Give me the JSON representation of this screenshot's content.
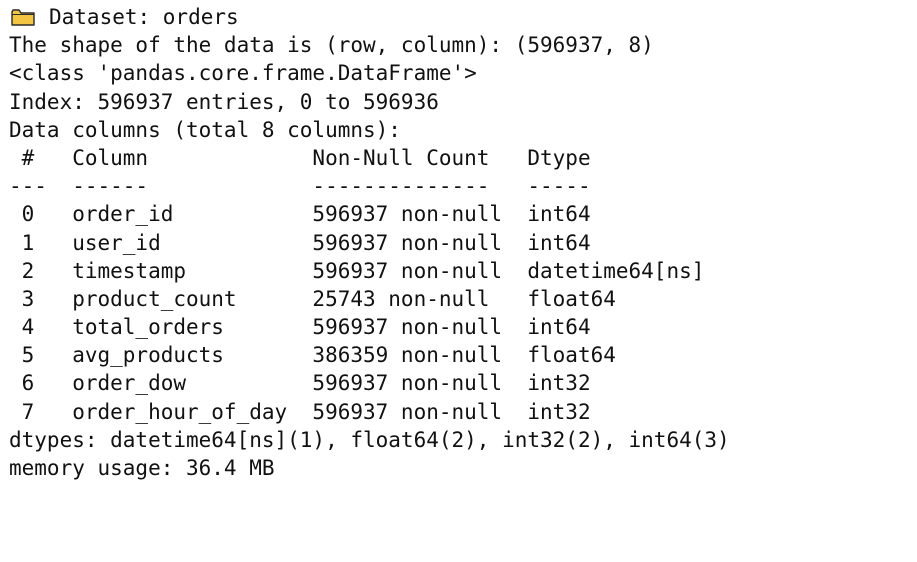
{
  "header": {
    "dataset_line": "Dataset: orders",
    "shape_line": "The shape of the data is (row, column): (596937, 8)",
    "class_line": "<class 'pandas.core.frame.DataFrame'>",
    "index_line": "Index: 596937 entries, 0 to 596936",
    "columns_line": "Data columns (total 8 columns):"
  },
  "table": {
    "header_line": " #   Column             Non-Null Count   Dtype         ",
    "separator_line": "---  ------             --------------   -----         ",
    "rows": [
      " 0   order_id           596937 non-null  int64         ",
      " 1   user_id            596937 non-null  int64         ",
      " 2   timestamp          596937 non-null  datetime64[ns]",
      " 3   product_count      25743 non-null   float64       ",
      " 4   total_orders       596937 non-null  int64         ",
      " 5   avg_products       386359 non-null  float64       ",
      " 6   order_dow          596937 non-null  int32         ",
      " 7   order_hour_of_day  596937 non-null  int32         "
    ]
  },
  "footer": {
    "dtypes_line": "dtypes: datetime64[ns](1), float64(2), int32(2), int64(3)",
    "memory_line": "memory usage: 36.4 MB"
  },
  "colors": {
    "folder_fill": "#F4C542",
    "folder_outline": "#2b2b2b",
    "text": "#111111",
    "background": "#ffffff"
  },
  "icons": {
    "dataset": "folder-icon"
  }
}
